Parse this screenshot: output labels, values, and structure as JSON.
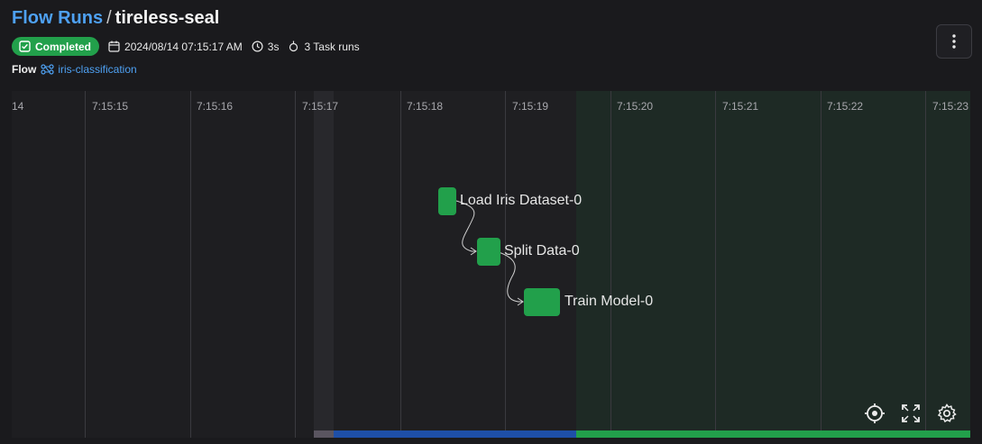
{
  "header": {
    "breadcrumb": "Flow Runs",
    "separator": "/",
    "run_name": "tireless-seal"
  },
  "status": {
    "badge": "Completed",
    "start_time": "2024/08/14 07:15:17 AM",
    "duration": "3s",
    "task_runs": "3 Task runs"
  },
  "flow": {
    "label": "Flow",
    "name": "iris-classification"
  },
  "timeline": {
    "ticks": [
      "14",
      "7:15:15",
      "7:15:16",
      "7:15:17",
      "7:15:18",
      "7:15:19",
      "7:15:20",
      "7:15:21",
      "7:15:22",
      "7:15:23"
    ],
    "tasks": [
      {
        "name": "Load Iris Dataset-0",
        "state": "Completed"
      },
      {
        "name": "Split Data-0",
        "state": "Completed"
      },
      {
        "name": "Train Model-0",
        "state": "Completed"
      }
    ]
  },
  "colors": {
    "accent_link": "#4ea1f3",
    "completed": "#22a04b",
    "running": "#1e4fa8",
    "pending": "#5a5560"
  },
  "icons": {
    "badge": "check-square-icon",
    "start": "calendar-icon",
    "duration": "clock-icon",
    "task_runs": "task-run-icon",
    "flow": "flow-icon",
    "menu": "kebab-menu-icon",
    "recenter": "crosshair-icon",
    "fullscreen": "fullscreen-icon",
    "settings": "gear-icon"
  }
}
